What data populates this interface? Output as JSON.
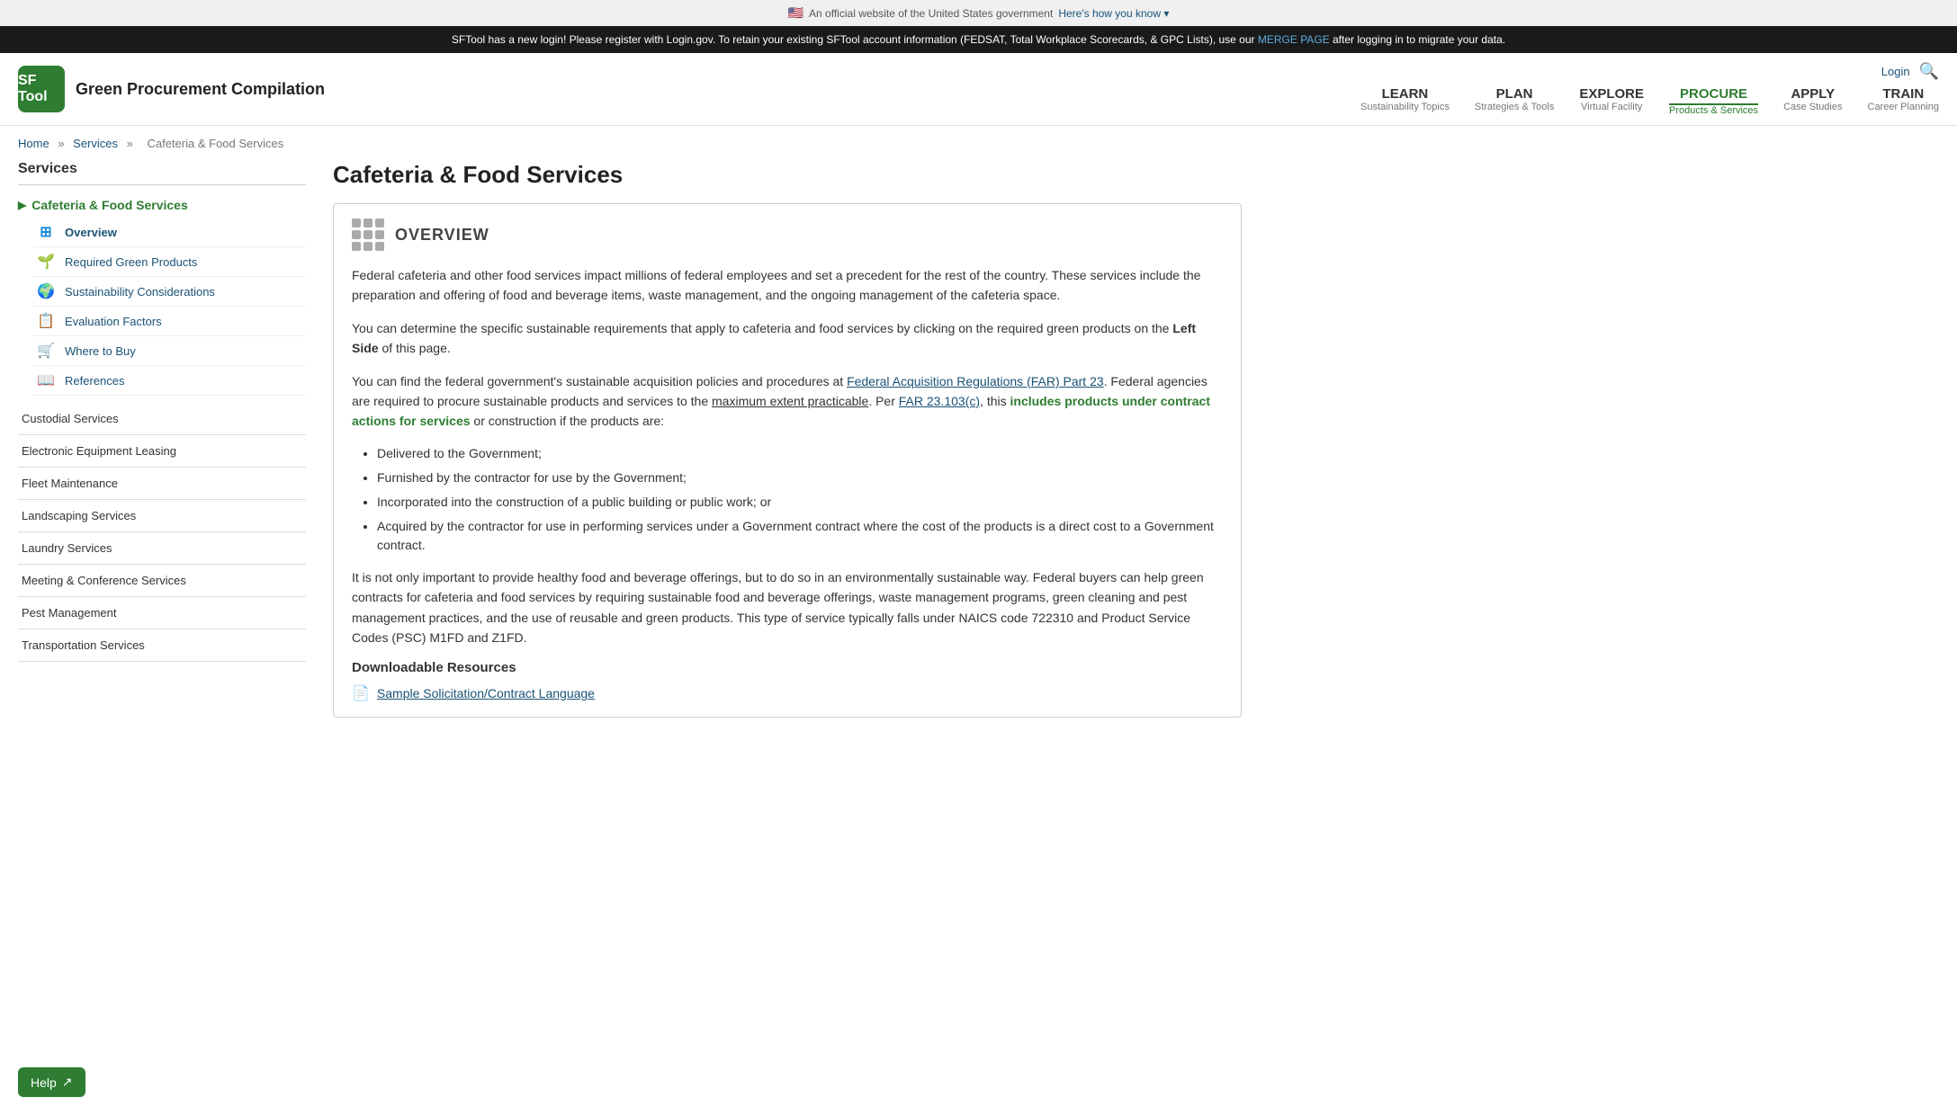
{
  "gov_banner": {
    "flag": "🇺🇸",
    "text": "An official website of the United States government",
    "link_text": "Here's how you know",
    "arrow": "▾"
  },
  "alert": {
    "text1": "SFTool has a new login! Please register with Login.gov. To retain your existing SFTool account information (FEDSAT, Total Workplace Scorecards, & GPC Lists), use our",
    "link_text": "MERGE PAGE",
    "text2": "after logging in to migrate your data."
  },
  "header": {
    "logo_text": "SF Tool",
    "site_title": "Green Procurement Compilation",
    "login_label": "Login",
    "nav": [
      {
        "id": "learn",
        "label": "LEARN",
        "sub": "Sustainability Topics",
        "active": false
      },
      {
        "id": "plan",
        "label": "PLAN",
        "sub": "Strategies & Tools",
        "active": false
      },
      {
        "id": "explore",
        "label": "EXPLORE",
        "sub": "Virtual Facility",
        "active": false
      },
      {
        "id": "procure",
        "label": "PROCURE",
        "sub": "Products & Services",
        "active": true
      },
      {
        "id": "apply",
        "label": "APPLY",
        "sub": "Case Studies",
        "active": false
      },
      {
        "id": "train",
        "label": "TRAIN",
        "sub": "Career Planning",
        "active": false
      }
    ]
  },
  "breadcrumb": {
    "items": [
      "Home",
      "Services",
      "Cafeteria & Food Services"
    ],
    "separator": "»"
  },
  "sidebar": {
    "title": "Services",
    "active_section": "Cafeteria & Food Services",
    "sub_items": [
      {
        "label": "Overview",
        "icon": "⊞",
        "active": true
      },
      {
        "label": "Required Green Products",
        "icon": "🌱",
        "active": false
      },
      {
        "label": "Sustainability Considerations",
        "icon": "🌍",
        "active": false
      },
      {
        "label": "Evaluation Factors",
        "icon": "📋",
        "active": false
      },
      {
        "label": "Where to Buy",
        "icon": "🛒",
        "active": false
      },
      {
        "label": "References",
        "icon": "📖",
        "active": false
      }
    ],
    "other_items": [
      "Custodial Services",
      "Electronic Equipment Leasing",
      "Fleet Maintenance",
      "Landscaping Services",
      "Laundry Services",
      "Meeting & Conference Services",
      "Pest Management",
      "Transportation Services"
    ]
  },
  "main": {
    "page_title": "Cafeteria & Food Services",
    "overview_title": "OVERVIEW",
    "paragraphs": [
      "Federal cafeteria and other food services impact millions of federal employees and set a precedent for the rest of the country.  These services include the preparation and offering of food and beverage items, waste management, and the ongoing management of the cafeteria space.",
      "You can determine the specific sustainable requirements that apply to cafeteria and food services by clicking on the required green products on the Left Side of this page.",
      "You can find the federal government's sustainable acquisition policies and procedures at Federal Acquisition Regulations (FAR) Part 23. Federal agencies are required to procure sustainable products and services to the maximum extent practicable. Per FAR 23.103(c), this includes products under contract actions for services or construction if the products are:"
    ],
    "bullet_items": [
      "Delivered to the Government;",
      "Furnished by the contractor for use by the Government;",
      "Incorporated into the construction of a public building or public work; or",
      "Acquired by the contractor for use in performing services under a Government contract where the cost of the products is a direct cost to a Government contract."
    ],
    "paragraph2": "It is not only important to provide healthy food and beverage offerings, but to do so in an environmentally sustainable way.  Federal buyers can help green contracts for cafeteria and food services by requiring sustainable food and beverage offerings, waste management programs, green cleaning and pest management practices, and the use of reusable and green products.  This type of service typically falls under NAICS code 722310 and Product Service Codes (PSC) M1FD and Z1FD.",
    "downloadable_heading": "Downloadable Resources",
    "resources": [
      {
        "label": "Sample Solicitation/Contract Language",
        "icon": "📄"
      }
    ],
    "links": {
      "far_part23": "Federal Acquisition Regulations (FAR) Part 23",
      "max_extent": "maximum extent practicable",
      "far_23103c": "FAR 23.103(c)",
      "contract_actions": "includes products under contract actions for services"
    }
  },
  "help_button": {
    "label": "Help",
    "icon": "↗"
  }
}
